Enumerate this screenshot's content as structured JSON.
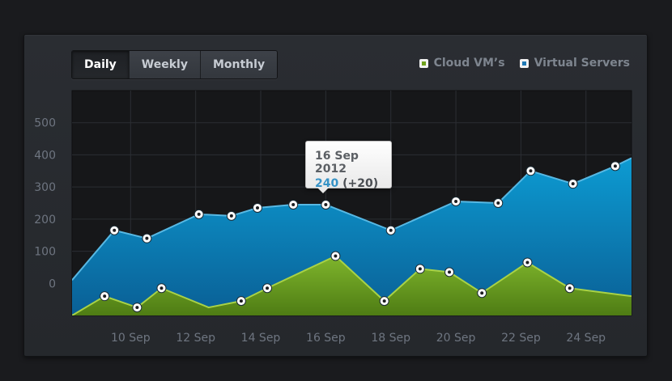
{
  "tabs": [
    {
      "label": "Daily",
      "active": true
    },
    {
      "label": "Weekly",
      "active": false
    },
    {
      "label": "Monthly",
      "active": false
    }
  ],
  "legend": [
    {
      "label": "Cloud VM’s",
      "color": "#6fa21c"
    },
    {
      "label": "Virtual Servers",
      "color": "#1f79b5"
    }
  ],
  "tooltip": {
    "date": "16 Sep 2012",
    "value": "240",
    "change": "(+20)"
  },
  "chart_data": {
    "type": "area",
    "xlim": [
      8.2,
      25.4
    ],
    "ylim": [
      -100,
      600
    ],
    "yticks": [
      0,
      100,
      200,
      300,
      400,
      500
    ],
    "xticks": [
      10,
      12,
      14,
      16,
      18,
      20,
      22,
      24
    ],
    "xticklabels": [
      "10 Sep",
      "12 Sep",
      "14 Sep",
      "16 Sep",
      "18 Sep",
      "20 Sep",
      "22 Sep",
      "24 Sep"
    ],
    "grid": true,
    "legend_position": "top-right",
    "series": [
      {
        "name": "Virtual Servers",
        "color": "#1f79b5",
        "line": "#57b8e3",
        "x": [
          8.2,
          9.5,
          10.5,
          12.1,
          13.1,
          13.9,
          15.0,
          16.0,
          18.0,
          20.0,
          21.3,
          22.3,
          23.6,
          24.9,
          25.4
        ],
        "y": [
          10,
          165,
          140,
          215,
          210,
          235,
          245,
          245,
          165,
          255,
          250,
          350,
          310,
          365,
          390
        ],
        "markers": [
          false,
          true,
          true,
          true,
          true,
          true,
          true,
          true,
          true,
          true,
          true,
          true,
          true,
          true,
          false
        ]
      },
      {
        "name": "Cloud VM’s",
        "color": "#6fa21c",
        "line": "#a9d245",
        "x": [
          8.2,
          9.2,
          10.2,
          10.95,
          12.4,
          13.4,
          14.2,
          16.3,
          17.8,
          18.9,
          19.8,
          20.8,
          22.2,
          23.5,
          25.4
        ],
        "y": [
          -100,
          -40,
          -75,
          -15,
          -75,
          -55,
          -15,
          85,
          -55,
          45,
          35,
          -30,
          65,
          -15,
          -40
        ],
        "markers": [
          false,
          true,
          true,
          true,
          false,
          true,
          true,
          true,
          true,
          true,
          true,
          true,
          true,
          true,
          false
        ]
      }
    ]
  }
}
